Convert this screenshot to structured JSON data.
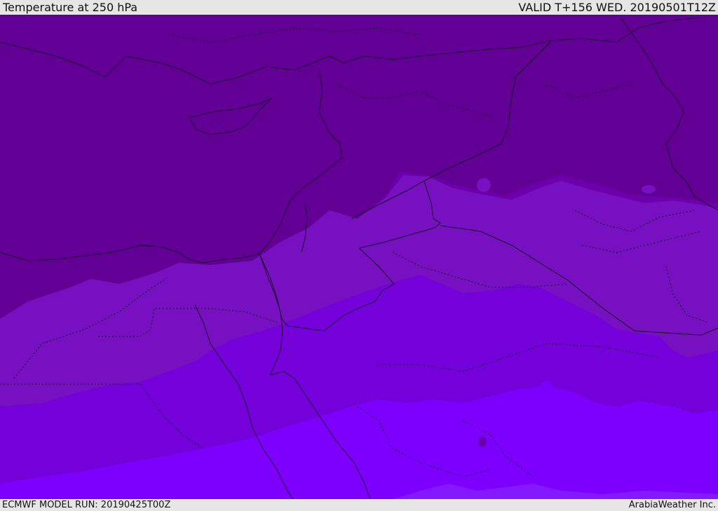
{
  "header": {
    "title": "Temperature at 250 hPa",
    "valid_time": "VALID T+156 WED. 20190501T12Z"
  },
  "footer": {
    "model_run": "ECMWF MODEL RUN: 20190425T00Z",
    "credit": "ArabiaWeather Inc."
  },
  "map": {
    "colors": {
      "band_coldest": "#620096",
      "band_cold": "#6c00ad",
      "band_mid": "#7710c0",
      "band_warm": "#7400da",
      "band_warmest": "#7d00ff",
      "band_edge": "#8418ff",
      "coastline": "#1c0a28",
      "border": "#140a20"
    }
  }
}
